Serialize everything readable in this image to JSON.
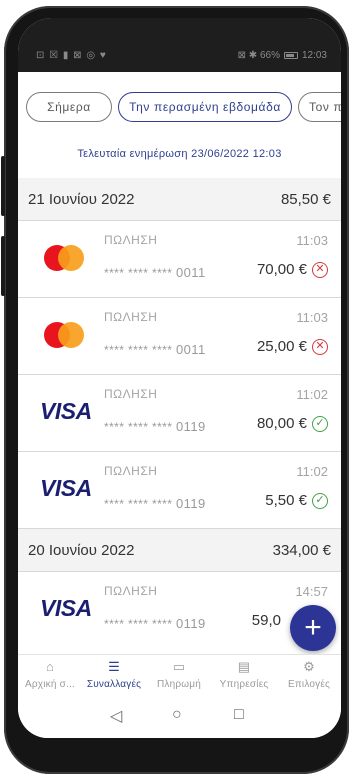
{
  "status_bar": {
    "left_icons": "⊡ ☒ ▮ ⊠ ◎ ♥",
    "right_text": "⊠ ✱ 66%",
    "time": "12:03"
  },
  "chips": [
    "Σήμερα",
    "Την περασμένη εβδομάδα",
    "Τον περα"
  ],
  "last_update": "Τελευταία ενημέρωση 23/06/2022 12:03",
  "days": [
    {
      "date": "21 Ιουνίου 2022",
      "total": "85,50 €"
    },
    {
      "date": "20 Ιουνίου 2022",
      "total": "334,00 €"
    }
  ],
  "transactions": [
    {
      "brand": "mastercard",
      "type": "ΠΩΛΗΣΗ",
      "time": "11:03",
      "card_mask": "**** **** ****",
      "card_last": "0011",
      "amount": "70,00 €",
      "status": "failed"
    },
    {
      "brand": "mastercard",
      "type": "ΠΩΛΗΣΗ",
      "time": "11:03",
      "card_mask": "**** **** ****",
      "card_last": "0011",
      "amount": "25,00 €",
      "status": "failed"
    },
    {
      "brand": "visa",
      "brand_label": "VISA",
      "type": "ΠΩΛΗΣΗ",
      "time": "11:02",
      "card_mask": "**** **** ****",
      "card_last": "0119",
      "amount": "80,00 €",
      "status": "success"
    },
    {
      "brand": "visa",
      "brand_label": "VISA",
      "type": "ΠΩΛΗΣΗ",
      "time": "11:02",
      "card_mask": "**** **** ****",
      "card_last": "0119",
      "amount": "5,50 €",
      "status": "success"
    },
    {
      "brand": "visa",
      "brand_label": "VISA",
      "type": "ΠΩΛΗΣΗ",
      "time": "14:57",
      "card_mask": "**** **** ****",
      "card_last": "0119",
      "amount": "59,0",
      "status": "hidden"
    }
  ],
  "fab": {
    "label": "+"
  },
  "bottom_nav": [
    {
      "label": "Αρχική σ...",
      "icon": "home-icon"
    },
    {
      "label": "Συναλλαγές",
      "icon": "list-icon",
      "active": true
    },
    {
      "label": "Πληρωμή",
      "icon": "payment-icon"
    },
    {
      "label": "Υπηρεσίες",
      "icon": "services-icon"
    },
    {
      "label": "Επιλογές",
      "icon": "settings-icon"
    }
  ],
  "system_nav": {
    "back": "◁",
    "home": "○",
    "recents": "□"
  },
  "colors": {
    "accent": "#2f3f8f",
    "fab": "#2c3596",
    "failed": "#d23a3a",
    "success": "#43a047",
    "visa": "#1a1f71"
  }
}
